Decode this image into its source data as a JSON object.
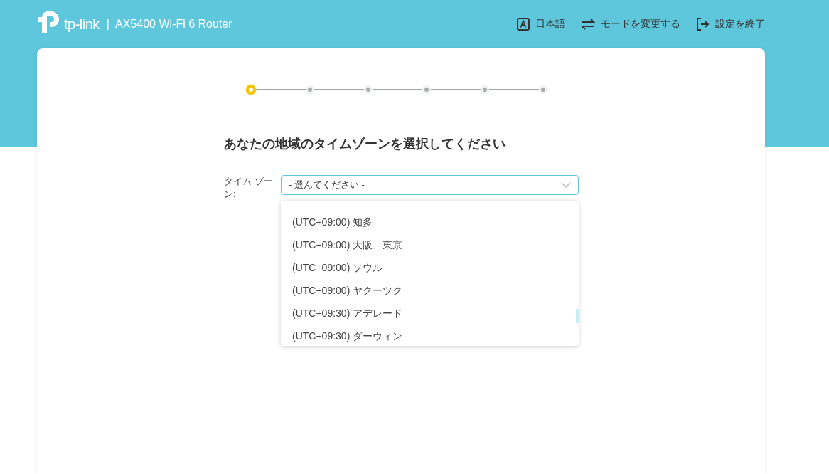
{
  "header": {
    "brand": "tp-link",
    "separator": "|",
    "model": "AX5400 Wi-Fi 6 Router",
    "actions": [
      {
        "kind": "language",
        "label": "日本語"
      },
      {
        "kind": "mode",
        "label": "モードを変更する"
      },
      {
        "kind": "exit",
        "label": "設定を終了"
      }
    ]
  },
  "stepper": [
    {
      "selected": true
    },
    {
      "selected": false
    },
    {
      "selected": false
    },
    {
      "selected": false
    },
    {
      "selected": false
    },
    {
      "selected": false
    }
  ],
  "title": "あなたの地域のタイムゾーンを選択してください",
  "timezone": {
    "label": "タイム ゾーン:",
    "value": "- 選んでください -",
    "expanded": true,
    "options": [
      {
        "label": "(UTC+09:00) 知多",
        "selected": false
      },
      {
        "label": "(UTC+09:00) 大阪、東京",
        "selected": false
      },
      {
        "label": "(UTC+09:00) ソウル",
        "selected": false
      },
      {
        "label": "(UTC+09:00) ヤクーツク",
        "selected": false
      },
      {
        "label": "(UTC+09:30) アデレード",
        "selected": false
      },
      {
        "label": "(UTC+09:30) ダーウィン",
        "selected": false
      }
    ]
  }
}
